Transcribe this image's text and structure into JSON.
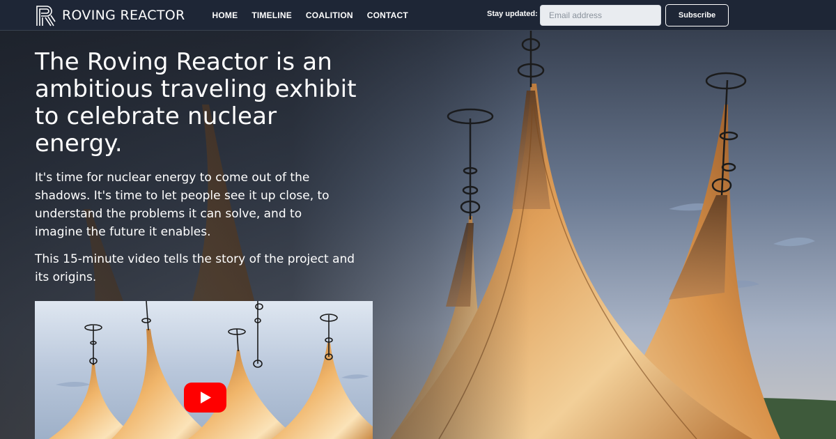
{
  "brand": {
    "name": "ROVING REACTOR",
    "logo_icon": "r-monogram-icon"
  },
  "nav": {
    "items": [
      "HOME",
      "TIMELINE",
      "COALITION",
      "CONTACT"
    ]
  },
  "newsletter": {
    "label": "Stay updated:",
    "placeholder": "Email address",
    "value": "",
    "button_label": "Subscribe"
  },
  "hero": {
    "title": "The Roving Reactor is an ambitious traveling exhibit to celebrate nuclear energy.",
    "paragraphs": [
      "It's time for nuclear energy to come out of the shadows. It's time to let people see it up close, to understand the problems it can solve, and to imagine the future it enables.",
      "This 15-minute video tells the story of the project and its origins."
    ]
  },
  "video": {
    "play_icon": "youtube-play-icon"
  },
  "colors": {
    "nav_bg": "#1e2636",
    "tent_orange": "#d38a3e",
    "sky": "#6f7f97",
    "youtube_red": "#ff0000"
  }
}
